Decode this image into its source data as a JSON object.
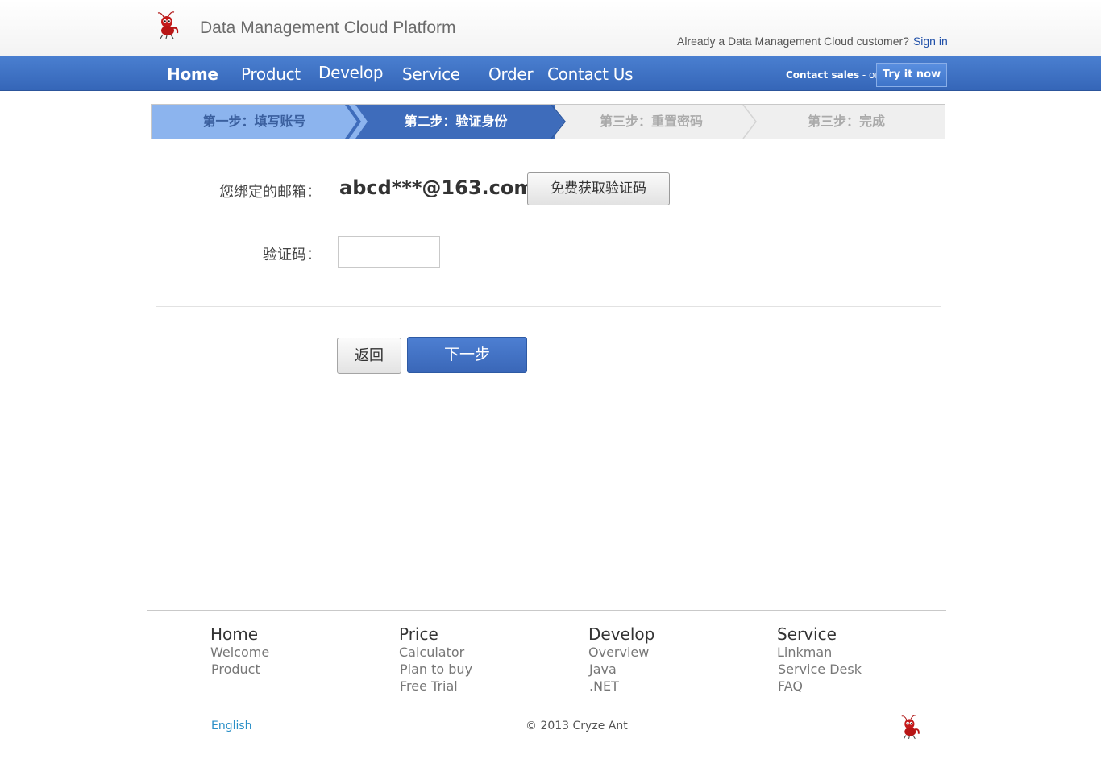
{
  "header": {
    "logo_icon": "red-ant-logo-icon",
    "site_title": "Data Management Cloud Platform",
    "signin_prompt": "Already a Data Management Cloud customer?",
    "signin_link": "Sign in"
  },
  "nav": {
    "items": [
      {
        "label": "Home",
        "active": true
      },
      {
        "label": "Product"
      },
      {
        "label": "Develop"
      },
      {
        "label": "Service"
      },
      {
        "label": "Order"
      },
      {
        "label": "Contact Us"
      }
    ],
    "contact_sales": "Contact sales",
    "or_text": " - or - ",
    "try_button": "Try it now"
  },
  "steps": [
    {
      "label": "第一步：填写账号",
      "state": "done"
    },
    {
      "label": "第二步：验证身份",
      "state": "current"
    },
    {
      "label": "第三步：重置密码",
      "state": "todo"
    },
    {
      "label": "第三步：完成",
      "state": "todo"
    }
  ],
  "form": {
    "email_label": "您绑定的邮箱：",
    "email_value": "abcd***@163.com",
    "get_code_button": "免费获取验证码",
    "code_label": "验证码：",
    "code_value": "",
    "back_button": "返回",
    "next_button": "下一步"
  },
  "footer": {
    "columns": [
      {
        "title": "Home",
        "links": [
          "Welcome",
          "Product"
        ]
      },
      {
        "title": "Price",
        "links": [
          "Calculator",
          "Plan to buy",
          "Free Trial"
        ]
      },
      {
        "title": "Develop",
        "links": [
          "Overview",
          "Java",
          ".NET"
        ]
      },
      {
        "title": "Service",
        "links": [
          "Linkman",
          "Service Desk",
          "FAQ"
        ]
      }
    ],
    "language": "English",
    "copyright": "© 2013 Cryze Ant"
  },
  "colors": {
    "nav_blue": "#3d6fc3",
    "step_done": "#8cb4ee",
    "step_current": "#3e6cbb",
    "link_blue": "#1f4fa8"
  }
}
